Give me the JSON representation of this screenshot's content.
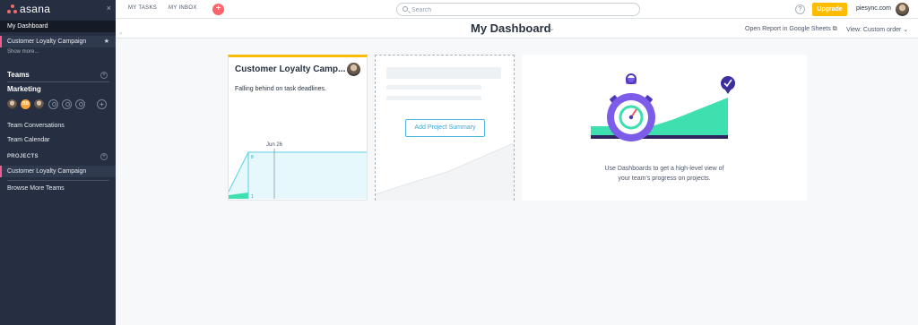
{
  "sidebar": {
    "logo_text": "asana",
    "close": "×",
    "items": [
      {
        "label": "My Dashboard"
      },
      {
        "label": "Customer Loyalty Campaign"
      }
    ],
    "show_more": "Show more...",
    "teams_title": "Teams",
    "team_name": "Marketing",
    "avatar_initials": "BB",
    "team_links": [
      "Team Conversations",
      "Team Calendar"
    ],
    "projects_title": "PROJECTS",
    "project_item": "Customer Loyalty Campaign",
    "browse_teams": "Browse More Teams"
  },
  "topbar": {
    "my_tasks": "MY TASKS",
    "my_inbox": "MY INBOX",
    "quick_add": "+",
    "search_placeholder": "Search",
    "help": "?",
    "upgrade": "Upgrade",
    "org_name": "piesync.com"
  },
  "titlebar": {
    "title": "My Dashboard",
    "chevron": "⌄",
    "open_report": "Open Report in Google Sheets ⧉",
    "view_order": "View: Custom order ⌄"
  },
  "cards": {
    "project_card": {
      "title": "Customer Loyalty Camp...",
      "status": "Falling behind on task deadlines.",
      "chart": {
        "date_label": "Jun 26",
        "y_top": "8",
        "y_bottom": "1"
      }
    },
    "add_card": {
      "button": "Add Project Summary"
    },
    "promo_card": {
      "line1": "Use Dashboards to get a high-level view of",
      "line2": "your team's progress on projects."
    }
  },
  "colors": {
    "sidebar_bg": "#262f41",
    "accent_pink": "#f05d8f",
    "upgrade": "#fcbd01",
    "teal": "#3ee0b0",
    "purple": "#7c5ce8"
  }
}
